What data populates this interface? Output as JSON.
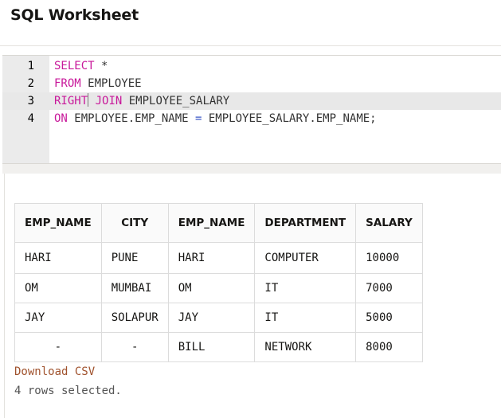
{
  "page": {
    "title": "SQL Worksheet"
  },
  "editor": {
    "lines": [
      {
        "number": "1",
        "keyword": "SELECT",
        "text": " *"
      },
      {
        "number": "2",
        "keyword": "FROM",
        "text": " EMPLOYEE"
      },
      {
        "number": "3",
        "keyword": "RIGHT",
        "keyword2": "JOIN",
        "text": " EMPLOYEE_SALARY"
      },
      {
        "number": "4",
        "keyword": "ON",
        "text": " EMPLOYEE.EMP_NAME ",
        "operator": "=",
        "text2": " EMPLOYEE_SALARY.EMP_NAME;"
      }
    ]
  },
  "results": {
    "columns": [
      "EMP_NAME",
      "CITY",
      "EMP_NAME",
      "DEPARTMENT",
      "SALARY"
    ],
    "rows": [
      [
        "HARI",
        "PUNE",
        "HARI",
        "COMPUTER",
        "10000"
      ],
      [
        "OM",
        "MUMBAI",
        "OM",
        "IT",
        "7000"
      ],
      [
        "JAY",
        "SOLAPUR",
        "JAY",
        "IT",
        "5000"
      ],
      [
        "-",
        "-",
        "BILL",
        "NETWORK",
        "8000"
      ]
    ],
    "download_label": "Download CSV",
    "status": "4 rows selected."
  },
  "colors": {
    "keyword": "#c8189a",
    "operator": "#3b57c6",
    "link": "#a0522d"
  }
}
